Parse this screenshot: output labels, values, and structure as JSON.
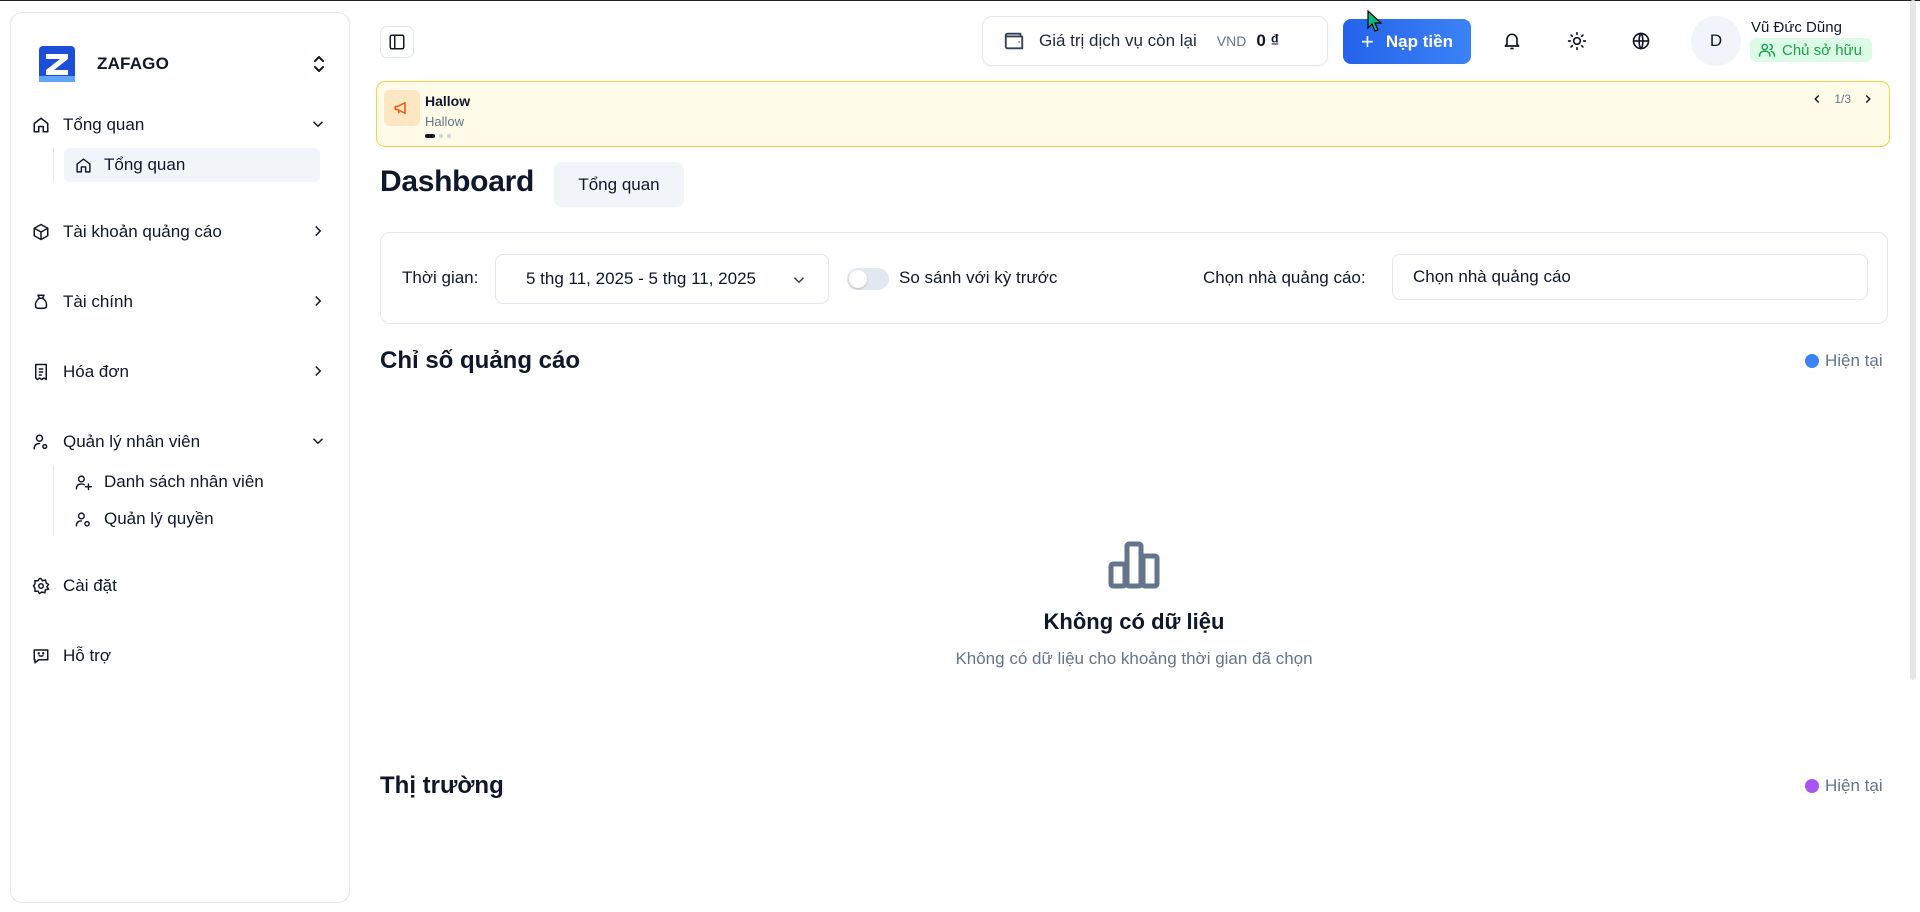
{
  "sidebar": {
    "brand": "ZAFAGO",
    "groups": [
      {
        "label": "Tổng quan",
        "expanded": true,
        "children": [
          {
            "label": "Tổng quan",
            "active": true
          }
        ]
      },
      {
        "label": "Tài khoản quảng cáo",
        "expanded": false
      },
      {
        "label": "Tài chính",
        "expanded": false
      },
      {
        "label": "Hóa đơn",
        "expanded": false
      },
      {
        "label": "Quản lý nhân viên",
        "expanded": true,
        "children": [
          {
            "label": "Danh sách nhân viên"
          },
          {
            "label": "Quản lý quyền"
          }
        ]
      },
      {
        "label": "Cài đặt"
      },
      {
        "label": "Hỗ trợ"
      }
    ]
  },
  "header": {
    "balance_label": "Giá trị dịch vụ còn lại",
    "currency": "VND",
    "balance_amount": "0 ₫",
    "deposit_label": "Nạp tiền",
    "user_initial": "D",
    "user_name": "Vũ Đức Dũng",
    "user_role": "Chủ sở hữu"
  },
  "announcement": {
    "title": "Hallow",
    "subtitle": "Hallow",
    "pager": "1/3"
  },
  "page": {
    "title": "Dashboard",
    "tab": "Tổng quan"
  },
  "filters": {
    "time_label": "Thời gian:",
    "date_range": "5 thg 11, 2025 - 5 thg 11, 2025",
    "compare_label": "So sánh với kỳ trước",
    "compare_on": false,
    "advertiser_label": "Chọn nhà quảng cáo:",
    "advertiser_placeholder": "Chọn nhà quảng cáo"
  },
  "sections": {
    "ads_title": "Chỉ số quảng cáo",
    "ads_legend": "Hiện tại",
    "ads_legend_color": "#3b82f6",
    "empty_title": "Không có dữ liệu",
    "empty_desc": "Không có dữ liệu cho khoảng thời gian đã chọn",
    "market_title": "Thị trường",
    "market_legend": "Hiện tại",
    "market_legend_color": "#a855f7"
  },
  "colors": {
    "accent": "#2563eb",
    "announce_bg": "#fefbe8",
    "announce_border": "#f6cf47",
    "role_bg": "#dcfce7",
    "role_text": "#16a34a"
  }
}
